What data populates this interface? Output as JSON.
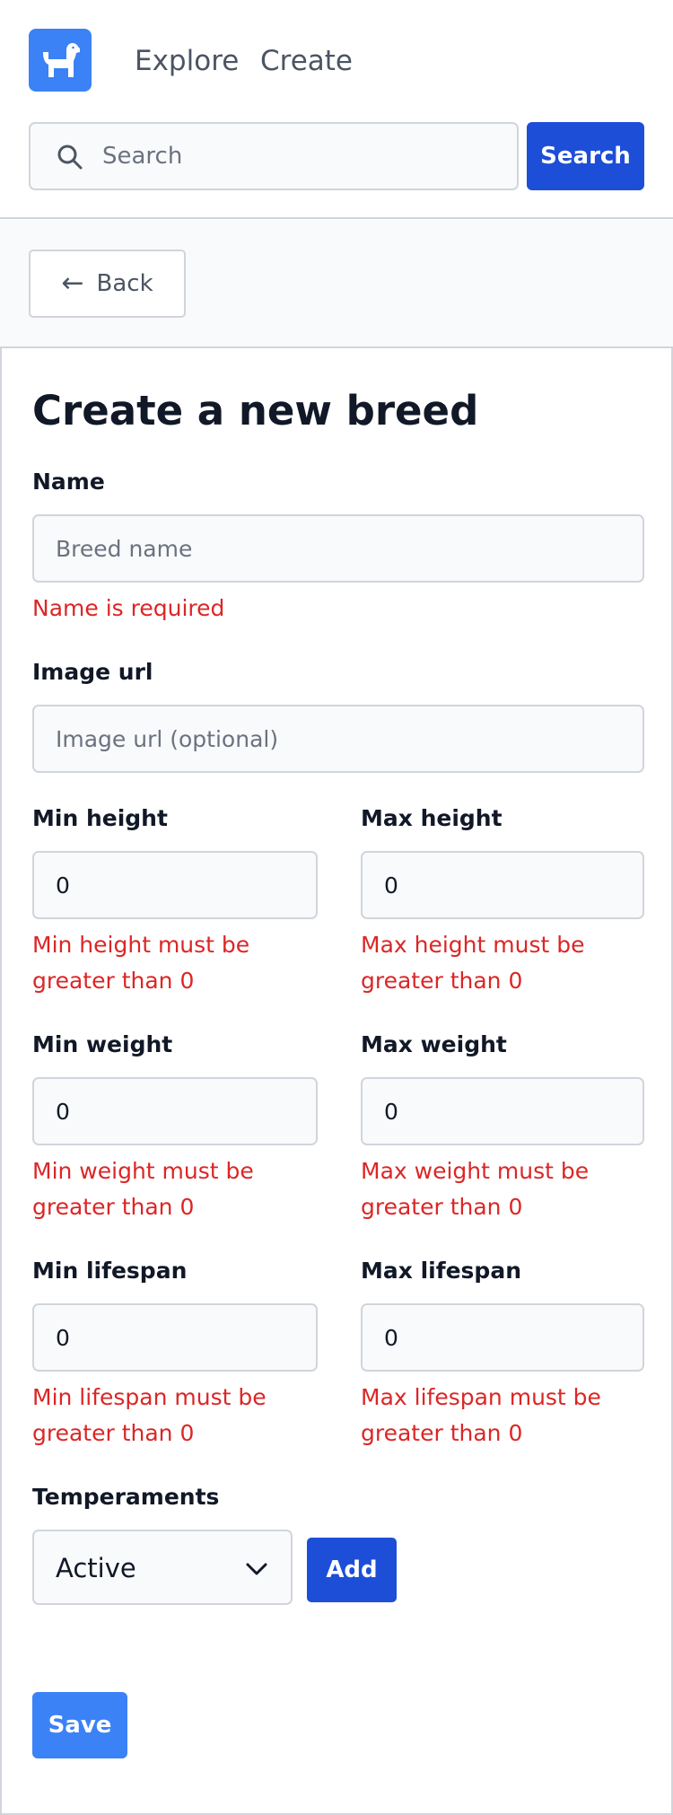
{
  "header": {
    "logo_icon": "dog-icon",
    "nav": {
      "explore": "Explore",
      "create": "Create"
    },
    "search": {
      "placeholder": "Search",
      "value": "",
      "button": "Search",
      "icon": "search-icon"
    }
  },
  "backbar": {
    "back_label": "Back",
    "back_icon": "arrow-left-icon"
  },
  "form": {
    "title": "Create a new breed",
    "name": {
      "label": "Name",
      "placeholder": "Breed name",
      "value": "",
      "error": "Name is required"
    },
    "image_url": {
      "label": "Image url",
      "placeholder": "Image url (optional)",
      "value": ""
    },
    "min_height": {
      "label": "Min height",
      "value": "0",
      "error": "Min height must be greater than 0"
    },
    "max_height": {
      "label": "Max height",
      "value": "0",
      "error": "Max height must be greater than 0"
    },
    "min_weight": {
      "label": "Min weight",
      "value": "0",
      "error": "Min weight must be greater than 0"
    },
    "max_weight": {
      "label": "Max weight",
      "value": "0",
      "error": "Max weight must be greater than 0"
    },
    "min_lifespan": {
      "label": "Min lifespan",
      "value": "0",
      "error": "Min lifespan must be greater than 0"
    },
    "max_lifespan": {
      "label": "Max lifespan",
      "value": "0",
      "error": "Max lifespan must be greater than 0"
    },
    "temperaments": {
      "label": "Temperaments",
      "selected": "Active",
      "add_button": "Add",
      "chevron_icon": "chevron-down-icon"
    },
    "save_button": "Save"
  },
  "colors": {
    "brand": "#3b82f6",
    "primary_button": "#1d4ed8",
    "error": "#dc2626",
    "border": "#d1d5db",
    "input_bg": "#f9fafb"
  }
}
